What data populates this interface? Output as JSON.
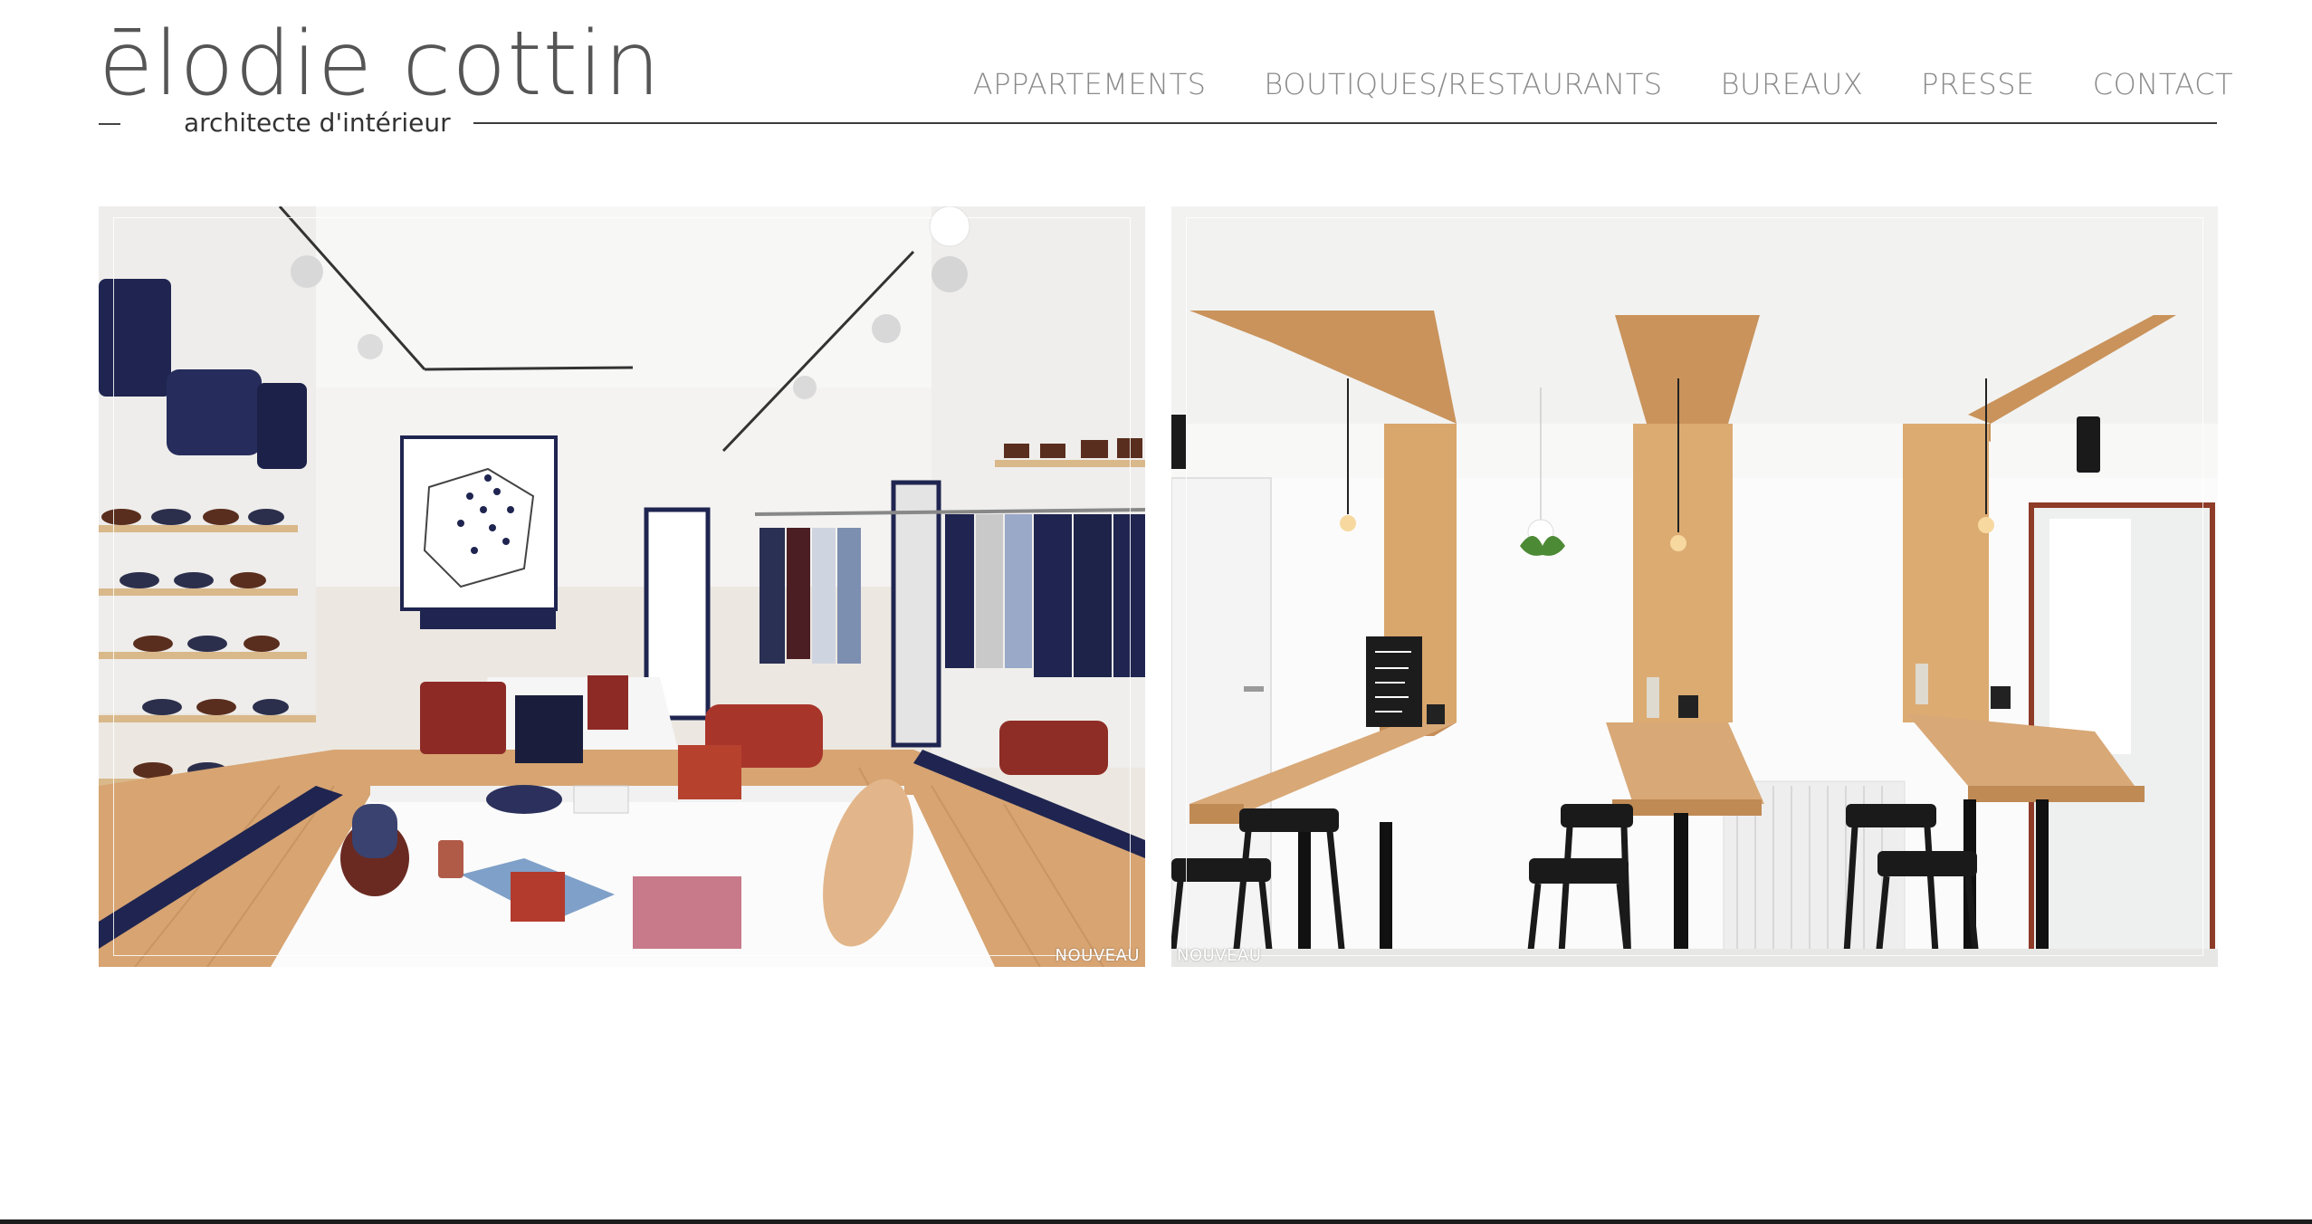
{
  "site": {
    "logo_name": "ēlodie cottin",
    "logo_subtitle": "architecte d'intérieur"
  },
  "nav": {
    "items": [
      {
        "label": "APPARTEMENTS"
      },
      {
        "label": "BOUTIQUES/RESTAURANTS"
      },
      {
        "label": "BUREAUX"
      },
      {
        "label": "PRESSE"
      },
      {
        "label": "CONTACT"
      }
    ]
  },
  "projects": [
    {
      "badge": "NOUVEAU",
      "image": "boutique-interior-photo"
    },
    {
      "badge": "NOUVEAU",
      "image": "cafe-bar-interior-photo"
    }
  ],
  "colors": {
    "nav_text": "#8a8a8a",
    "logo_text": "#555555",
    "rule": "#3c3c3c",
    "navy": "#1f2550",
    "oak": "#d7a877"
  }
}
